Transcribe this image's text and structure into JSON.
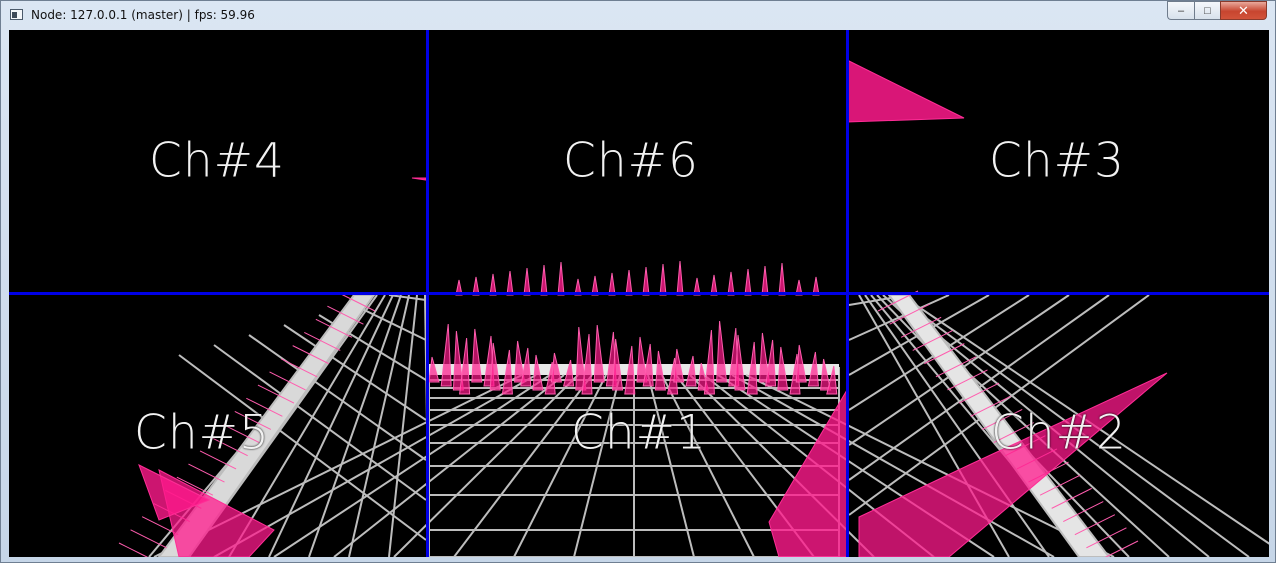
{
  "window": {
    "title": "Node: 127.0.0.1 (master) | fps: 59.96",
    "icon": "app-window-icon"
  },
  "caption_buttons": {
    "minimize": "–",
    "maximize": "□",
    "close": "✕"
  },
  "channels": [
    {
      "id": "ch4",
      "label": "Ch#4"
    },
    {
      "id": "ch6",
      "label": "Ch#6"
    },
    {
      "id": "ch3",
      "label": "Ch#3"
    },
    {
      "id": "ch5",
      "label": "Ch#5"
    },
    {
      "id": "ch1",
      "label": "Ch#1"
    },
    {
      "id": "ch2",
      "label": "Ch#2"
    }
  ],
  "colors": {
    "divider": "#0000e6",
    "spike": "#ff1a8c",
    "grid": "#bdbdbd",
    "background": "#000000",
    "label": "#f2f2f2"
  }
}
